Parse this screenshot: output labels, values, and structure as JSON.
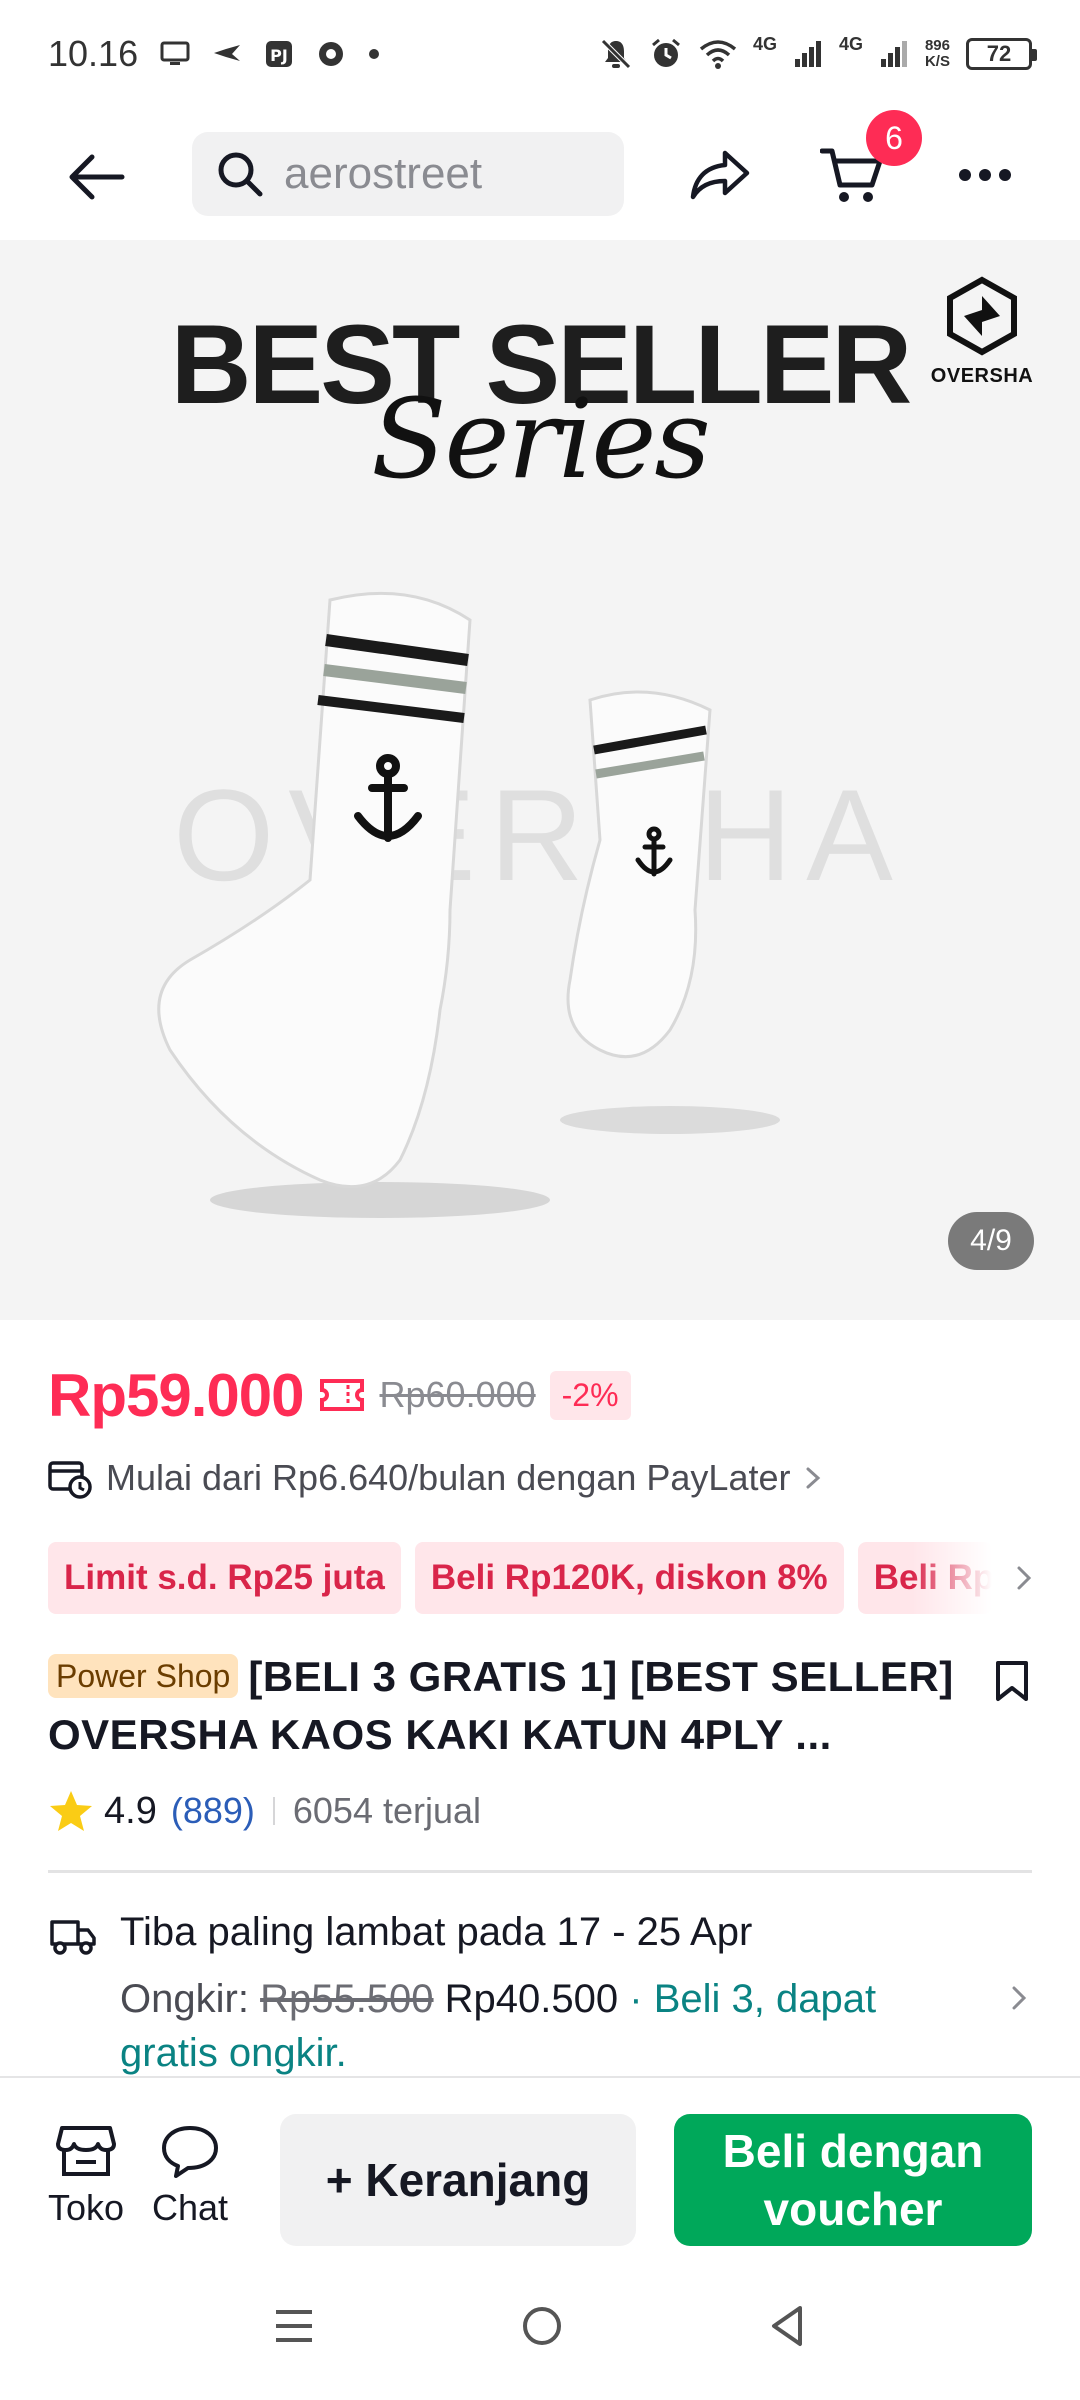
{
  "status_bar": {
    "time": "10.16",
    "net1": "4G",
    "net2": "4G",
    "speed_value": "896",
    "speed_unit": "K/S",
    "battery": "72"
  },
  "nav": {
    "search_text": "aerostreet",
    "cart_count": "6"
  },
  "gallery": {
    "headline": "BEST SELLER",
    "subline": "Series",
    "brand": "OVERSHA",
    "watermark": "OVERSHA",
    "page_indicator": "4/9"
  },
  "price": {
    "current": "Rp59.000",
    "original": "Rp60.000",
    "discount": "-2%"
  },
  "paylater": {
    "text": "Mulai dari Rp6.640/bulan dengan PayLater"
  },
  "promos": [
    {
      "label": "Limit s.d. Rp25 juta"
    },
    {
      "label": "Beli Rp120K, diskon 8%"
    },
    {
      "label": "Beli Rp"
    }
  ],
  "product": {
    "badge": "Power Shop",
    "title": "[BELI 3 GRATIS 1] [BEST SELLER] OVERSHA KAOS KAKI KATUN 4PLY  ..."
  },
  "rating": {
    "value": "4.9",
    "count": "(889)",
    "sold": "6054 terjual"
  },
  "shipping": {
    "title": "Tiba paling lambat pada 17 - 25 Apr",
    "label": "Ongkir:",
    "old_price": "Rp55.500",
    "new_price": "Rp40.500",
    "promo": "· Beli 3, dapat gratis ongkir."
  },
  "bottom_bar": {
    "shop_label": "Toko",
    "chat_label": "Chat",
    "cart_button": "+ Keranjang",
    "buy_button": "Beli dengan voucher"
  },
  "colors": {
    "accent": "#fe2c55",
    "buy": "#00a85a",
    "teal": "#0a8383"
  }
}
